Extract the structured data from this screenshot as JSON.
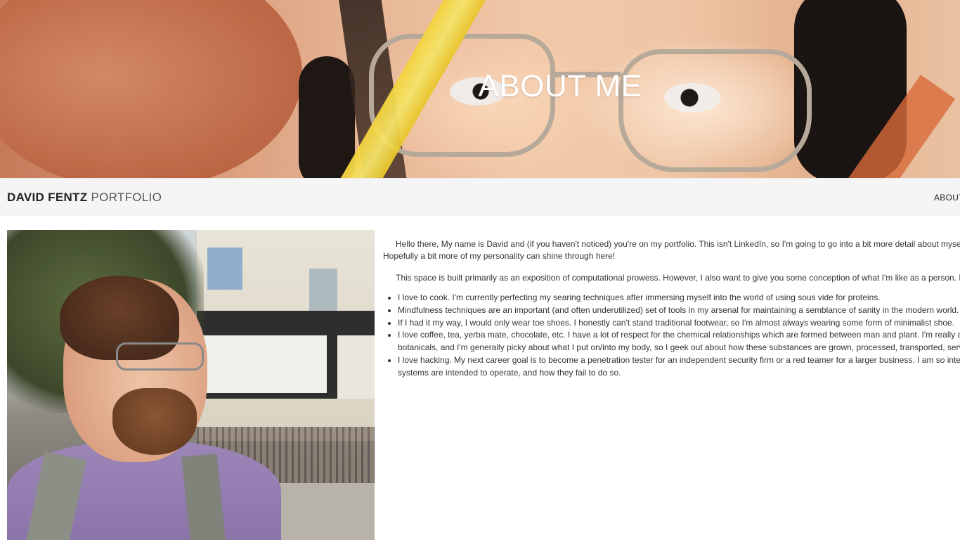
{
  "hero": {
    "title": "ABOUT ME"
  },
  "navbar": {
    "brand_name": "DAVID FENTZ",
    "brand_sub": "PORTFOLIO",
    "links": [
      {
        "label": "ABOUT"
      }
    ]
  },
  "content": {
    "paragraphs": [
      "Hello there, My name is David and (if you haven't noticed) you're on my portfolio. This isn't LinkedIn, so I'm going to go into a bit more detail about myself, r",
      "Hopefully a bit more of my personality can shine through here!",
      "This space is built primarily as an exposition of computational prowess. However, I also want to give you some conception of what I'm like as a person. He"
    ],
    "bullets": [
      "I love to cook. I'm currently perfecting my searing techniques after immersing myself into the world of using sous vide for proteins.",
      "Mindfulness techniques are an important (and often underutilized) set of tools in my arsenal for maintaining a semblance of sanity in the modern world.",
      "If I had it my way, I would only wear toe shoes. I honestly can't stand traditional footwear, so I'm almost always wearing some form of minimalist shoe.",
      "I love coffee, tea, yerba mate, chocolate, etc. I have a lot of respect for the chemical relationships which are formed between man and plant. I'm really a pu",
      "botanicals, and I'm generally picky about what I put on/into my body, so I geek out about how these substances are grown, processed, transported, servec",
      "I love hacking. My next career goal is to become a penetration tester for an independent security firm or a red teamer for a larger business. I am so interes",
      "systems are intended to operate, and how they fail to do so."
    ]
  }
}
